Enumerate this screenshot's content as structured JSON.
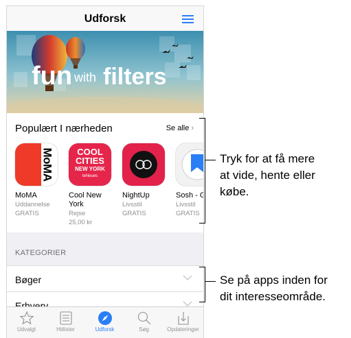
{
  "nav": {
    "title": "Udforsk",
    "menu_icon": "list-icon"
  },
  "banner": {
    "fun": "fun",
    "with": "with",
    "filters": "filters"
  },
  "popular": {
    "title": "Populært I nærheden",
    "see_all": "Se alle",
    "apps": [
      {
        "name": "MoMA",
        "category": "Uddannelse",
        "price": "GRATIS",
        "icon_text": "MoMA"
      },
      {
        "name": "Cool New York",
        "category": "Rejse",
        "price": "25,00 kr",
        "icon_line1": "COOL",
        "icon_line2": "CITIES",
        "icon_line3": "NEW YORK",
        "icon_line4": "teNeues"
      },
      {
        "name": "NightUp",
        "category": "Livsstil",
        "price": "GRATIS"
      },
      {
        "name": "Sosh - Guide",
        "category": "Livsstil",
        "price": "GRATIS"
      }
    ]
  },
  "categories": {
    "header": "KATEGORIER",
    "items": [
      "Bøger",
      "Erhverv"
    ]
  },
  "tabs": [
    {
      "label": "Udvalgt",
      "icon": "star-icon"
    },
    {
      "label": "Hitlister",
      "icon": "list-icon"
    },
    {
      "label": "Udforsk",
      "icon": "compass-icon",
      "active": true
    },
    {
      "label": "Søg",
      "icon": "search-icon"
    },
    {
      "label": "Opdateringer",
      "icon": "download-icon"
    }
  ],
  "callouts": {
    "apps_line1": "Tryk for at få mere",
    "apps_line2": "at vide, hente eller",
    "apps_line3": "købe.",
    "cat_line1": "Se på apps inden for",
    "cat_line2": "dit interesseområde."
  },
  "colors": {
    "accent": "#2a7ef6"
  }
}
